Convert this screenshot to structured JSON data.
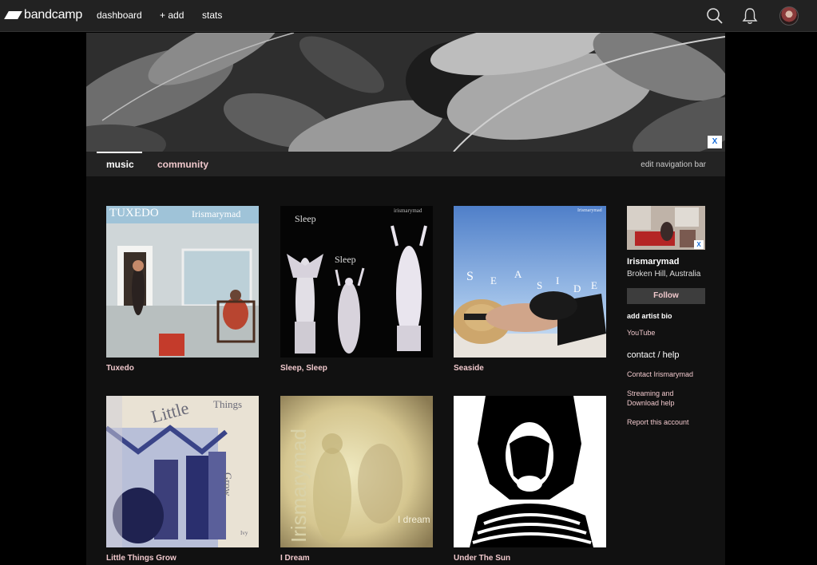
{
  "topbar": {
    "logo_text": "bandcamp",
    "nav": [
      "dashboard",
      "+ add",
      "stats"
    ],
    "icons": [
      "search-icon",
      "bell-icon",
      "avatar"
    ]
  },
  "banner": {
    "close_label": "X"
  },
  "subnav": {
    "tabs": [
      {
        "label": "music",
        "active": true,
        "color": "#ffffff"
      },
      {
        "label": "community",
        "active": false,
        "color": "#f0c8cc"
      }
    ],
    "edit_label": "edit navigation bar"
  },
  "albums": [
    {
      "title": "Tuxedo",
      "cover_text": [
        "TUXEDO",
        "Irismarymad"
      ]
    },
    {
      "title": "Sleep, Sleep",
      "cover_text": [
        "Sleep",
        "Sleep",
        "irismarymad"
      ]
    },
    {
      "title": "Seaside",
      "cover_text": [
        "S",
        "E",
        "A",
        "S",
        "I",
        "D",
        "E",
        "Irismarymad"
      ]
    },
    {
      "title": "Little Things Grow",
      "cover_text": [
        "Little",
        "Things",
        "Grow",
        "Ivy"
      ]
    },
    {
      "title": "I Dream",
      "cover_text": [
        "Irismarymad",
        "I dream"
      ]
    },
    {
      "title": "Under The Sun",
      "cover_text": []
    }
  ],
  "sidebar": {
    "photo_close": "X",
    "artist_name": "Irismarymad",
    "location": "Broken Hill, Australia",
    "follow_label": "Follow",
    "bio_label": "add artist bio",
    "youtube_label": "YouTube",
    "contact_heading": "contact / help",
    "links": [
      "Contact Irismarymad",
      "Streaming and Download help",
      "Report this account"
    ]
  },
  "colors": {
    "link_pink": "#f0c8cc",
    "topbar_bg": "#222222",
    "x_blue": "#1a6ed8"
  }
}
